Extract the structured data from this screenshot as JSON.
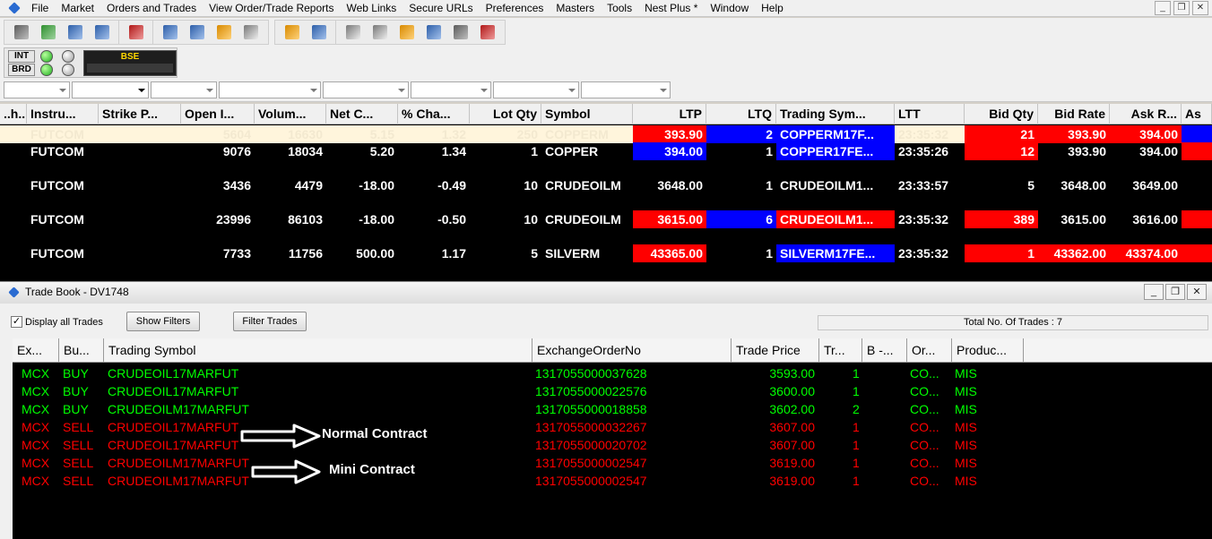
{
  "menu": {
    "items": [
      "File",
      "Market",
      "Orders and Trades",
      "View Order/Trade Reports",
      "Web Links",
      "Secure URLs",
      "Preferences",
      "Masters",
      "Tools",
      "Nest Plus *",
      "Window",
      "Help"
    ]
  },
  "window_controls": {
    "minimize": "_",
    "restore": "❐",
    "close": "✕"
  },
  "status": {
    "int_label": "INT",
    "brd_label": "BRD",
    "exchange_label": "BSE"
  },
  "market_watch": {
    "headers": [
      "..h..",
      "Instru...",
      "Strike P...",
      "Open I...",
      "Volum...",
      "Net C...",
      "% Cha...",
      "Lot Qty",
      "Symbol",
      "LTP",
      "LTQ",
      "Trading Sym...",
      "LTT",
      "Bid Qty",
      "Bid Rate",
      "Ask R...",
      "As"
    ],
    "rows": [
      {
        "instrument": "FUTCOM",
        "strike": "",
        "oi": "5604",
        "volume": "16630",
        "net_change": "5.15",
        "pct_change": "1.32",
        "lot_qty": "250",
        "symbol": "COPPERM",
        "ltp": "393.90",
        "ltq": "2",
        "trading_symbol": "COPPERM17F...",
        "ltt": "23:35:32",
        "bid_qty": "21",
        "bid_rate": "393.90",
        "ask_rate": "394.00"
      },
      {
        "instrument": "FUTCOM",
        "strike": "",
        "oi": "9076",
        "volume": "18034",
        "net_change": "5.20",
        "pct_change": "1.34",
        "lot_qty": "1",
        "symbol": "COPPER",
        "ltp": "394.00",
        "ltq": "1",
        "trading_symbol": "COPPER17FE...",
        "ltt": "23:35:26",
        "bid_qty": "12",
        "bid_rate": "393.90",
        "ask_rate": "394.00"
      },
      {
        "instrument": "FUTCOM",
        "strike": "",
        "oi": "3436",
        "volume": "4479",
        "net_change": "-18.00",
        "pct_change": "-0.49",
        "lot_qty": "10",
        "symbol": "CRUDEOILM",
        "ltp": "3648.00",
        "ltq": "1",
        "trading_symbol": "CRUDEOILM1...",
        "ltt": "23:33:57",
        "bid_qty": "5",
        "bid_rate": "3648.00",
        "ask_rate": "3649.00"
      },
      {
        "instrument": "FUTCOM",
        "strike": "",
        "oi": "23996",
        "volume": "86103",
        "net_change": "-18.00",
        "pct_change": "-0.50",
        "lot_qty": "10",
        "symbol": "CRUDEOILM",
        "ltp": "3615.00",
        "ltq": "6",
        "trading_symbol": "CRUDEOILM1...",
        "ltt": "23:35:32",
        "bid_qty": "389",
        "bid_rate": "3615.00",
        "ask_rate": "3616.00"
      },
      {
        "instrument": "FUTCOM",
        "strike": "",
        "oi": "7733",
        "volume": "11756",
        "net_change": "500.00",
        "pct_change": "1.17",
        "lot_qty": "5",
        "symbol": "SILVERM",
        "ltp": "43365.00",
        "ltq": "1",
        "trading_symbol": "SILVERM17FE...",
        "ltt": "23:35:32",
        "bid_qty": "1",
        "bid_rate": "43362.00",
        "ask_rate": "43374.00"
      }
    ]
  },
  "trade_book": {
    "title": "Trade Book - DV1748",
    "display_all_label": "Display all Trades",
    "display_all_checked": "✓",
    "show_filters_label": "Show Filters",
    "filter_trades_label": "Filter Trades",
    "total_trades": "Total No. Of Trades : 7",
    "headers": [
      "Ex...",
      "Bu...",
      "Trading Symbol",
      "ExchangeOrderNo",
      "Trade Price",
      "Tr...",
      "B -...",
      "Or...",
      "Produc..."
    ],
    "rows": [
      {
        "exchange": "MCX",
        "side": "BUY",
        "symbol": "CRUDEOIL17MARFUT",
        "order_no": "1317055000037628",
        "price": "3593.00",
        "qty": "1",
        "order_type": "CO...",
        "product": "MIS"
      },
      {
        "exchange": "MCX",
        "side": "BUY",
        "symbol": "CRUDEOIL17MARFUT",
        "order_no": "1317055000022576",
        "price": "3600.00",
        "qty": "1",
        "order_type": "CO...",
        "product": "MIS"
      },
      {
        "exchange": "MCX",
        "side": "BUY",
        "symbol": "CRUDEOILM17MARFUT",
        "order_no": "1317055000018858",
        "price": "3602.00",
        "qty": "2",
        "order_type": "CO...",
        "product": "MIS"
      },
      {
        "exchange": "MCX",
        "side": "SELL",
        "symbol": "CRUDEOIL17MARFUT",
        "order_no": "1317055000032267",
        "price": "3607.00",
        "qty": "1",
        "order_type": "CO...",
        "product": "MIS"
      },
      {
        "exchange": "MCX",
        "side": "SELL",
        "symbol": "CRUDEOIL17MARFUT",
        "order_no": "1317055000020702",
        "price": "3607.00",
        "qty": "1",
        "order_type": "CO...",
        "product": "MIS"
      },
      {
        "exchange": "MCX",
        "side": "SELL",
        "symbol": "CRUDEOILM17MARFUT",
        "order_no": "1317055000002547",
        "price": "3619.00",
        "qty": "1",
        "order_type": "CO...",
        "product": "MIS"
      },
      {
        "exchange": "MCX",
        "side": "SELL",
        "symbol": "CRUDEOILM17MARFUT",
        "order_no": "1317055000002547",
        "price": "3619.00",
        "qty": "1",
        "order_type": "CO...",
        "product": "MIS"
      }
    ]
  },
  "annotations": {
    "normal": "Normal Contract",
    "mini": "Mini Contract"
  },
  "colors": {
    "buy": "#00ff00",
    "sell": "#ff0000",
    "tick_up": "#ff0000",
    "tick_down": "#0000ff"
  }
}
